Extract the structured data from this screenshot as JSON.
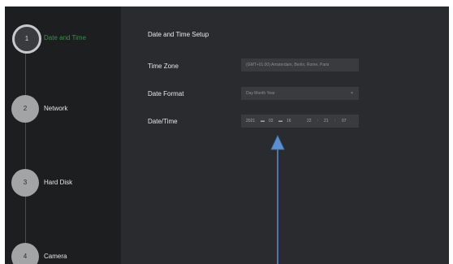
{
  "sidebar": {
    "steps": [
      {
        "number": "1",
        "label": "Date and Time"
      },
      {
        "number": "2",
        "label": "Network"
      },
      {
        "number": "3",
        "label": "Hard Disk"
      },
      {
        "number": "4",
        "label": "Camera"
      }
    ]
  },
  "main": {
    "title": "Date and Time Setup",
    "time_zone": {
      "label": "Time Zone",
      "value": "(GMT+01:00) Amsterdam, Berlin, Rome, Paris"
    },
    "date_format": {
      "label": "Date Format",
      "value": "Day Month Year"
    },
    "date_time": {
      "label": "Date/Time",
      "year": "2021",
      "month": "02",
      "day": "16",
      "hour": "22",
      "minute": "21",
      "second": "07"
    }
  },
  "colors": {
    "sidebar_bg": "#1d1e20",
    "content_bg": "#2a2b2f",
    "field_bg": "#3a3b3f",
    "active_step_text": "#3a8e4d",
    "annotation_arrow": "#5b8fd1"
  }
}
